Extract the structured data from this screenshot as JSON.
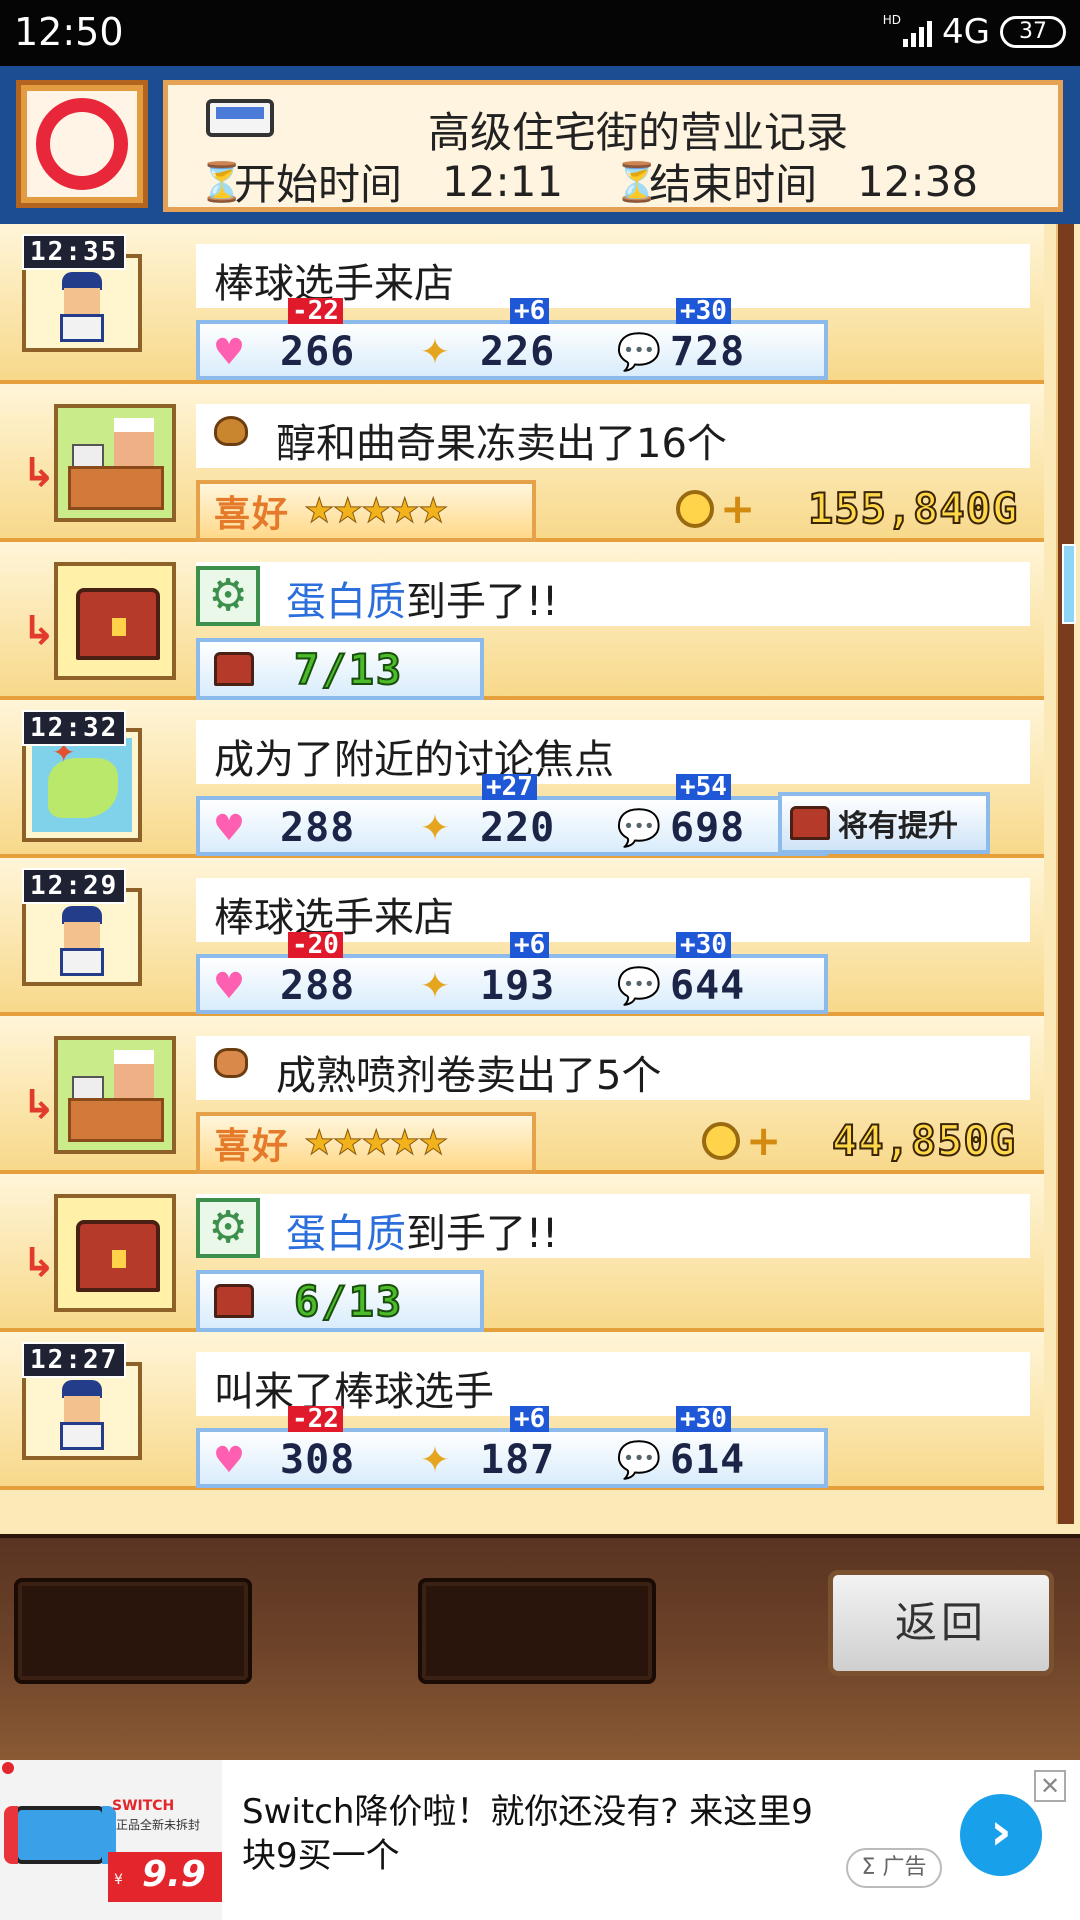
{
  "status_bar": {
    "time": "12:50",
    "hd": "HD",
    "network": "4G",
    "battery": "37"
  },
  "header": {
    "title": "高级住宅街的营业记录",
    "start_label": "开始时间",
    "start_time": "12:11",
    "end_label": "结束时间",
    "end_time": "12:38"
  },
  "log": {
    "r1": {
      "time": "12:35",
      "message": "棒球选手来店",
      "heart": "266",
      "heart_delta": "-22",
      "fav": "226",
      "fav_delta": "+6",
      "talk": "728",
      "talk_delta": "+30"
    },
    "r2": {
      "message": "醇和曲奇果冻卖出了16个",
      "pref_label": "喜好",
      "stars": "★★★★★",
      "money": "155,840G"
    },
    "r3": {
      "message_item": "蛋白质",
      "message_rest": "到手了!!",
      "count": "7/13"
    },
    "r4": {
      "time": "12:32",
      "message": "成为了附近的讨论焦点",
      "heart": "288",
      "fav": "220",
      "fav_delta": "+27",
      "talk": "698",
      "talk_delta": "+54",
      "upgrade": "将有提升"
    },
    "r5": {
      "time": "12:29",
      "message": "棒球选手来店",
      "heart": "288",
      "heart_delta": "-20",
      "fav": "193",
      "fav_delta": "+6",
      "talk": "644",
      "talk_delta": "+30"
    },
    "r6": {
      "message": "成熟喷剂卷卖出了5个",
      "pref_label": "喜好",
      "stars": "★★★★★",
      "money": "44,850G"
    },
    "r7": {
      "message_item": "蛋白质",
      "message_rest": "到手了!!",
      "count": "6/13"
    },
    "r8": {
      "time": "12:27",
      "message": "叫来了棒球选手",
      "heart": "308",
      "heart_delta": "-22",
      "fav": "187",
      "fav_delta": "+6",
      "talk": "614",
      "talk_delta": "+30"
    }
  },
  "buttons": {
    "back": "返回"
  },
  "ad": {
    "text": "Switch降价啦！就你还没有? 来这里9块9买一个",
    "tag": "Σ 广告",
    "brand": "SWITCH",
    "brand_sub": "正品全新未拆封",
    "price_prefix": "¥",
    "price": "9.9",
    "close": "✕",
    "go": "›"
  },
  "icons": {
    "heart": "heart-icon",
    "fav": "sparkle-icon",
    "talk": "speech-bubble-icon",
    "coin": "coin-icon",
    "gear": "gear-icon",
    "hourglass": "hourglass-icon"
  },
  "colors": {
    "accent_blue": "#2c6fdc",
    "negative_delta": "#e01a2a",
    "positive_delta": "#1f58d6",
    "ad_button": "#19a0ea"
  }
}
